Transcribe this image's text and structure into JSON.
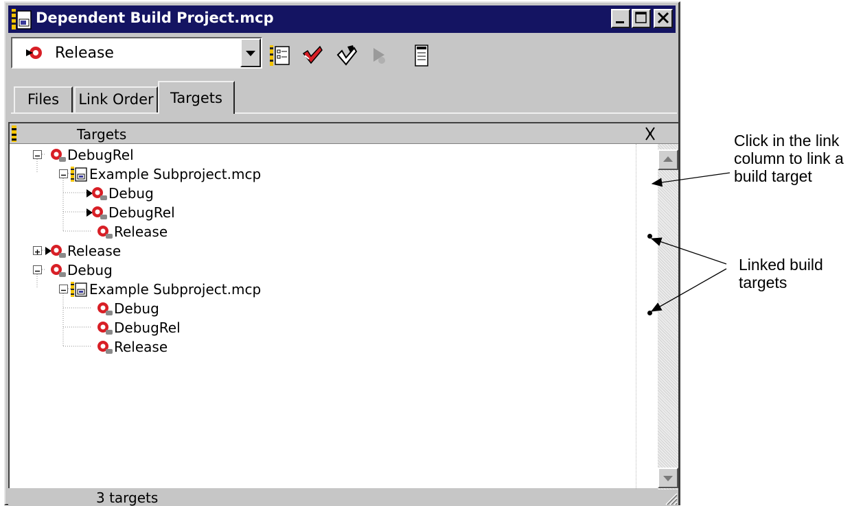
{
  "window": {
    "title": "Dependent Build Project.mcp",
    "controls": [
      "minimize",
      "maximize",
      "close"
    ]
  },
  "toolbar": {
    "target_selector_value": "Release",
    "buttons": [
      "settings-icon",
      "check-syntax-icon",
      "make-icon",
      "run-icon",
      "project-inspector-icon"
    ]
  },
  "tabs": [
    {
      "label": "Files",
      "active": false
    },
    {
      "label": "Link Order",
      "active": false
    },
    {
      "label": "Targets",
      "active": true
    }
  ],
  "list": {
    "column_header": "Targets",
    "tree": [
      {
        "label": "DebugRel",
        "type": "target",
        "level": 0,
        "expander": "minus",
        "linked": false
      },
      {
        "label": "Example Subproject.mcp",
        "type": "subproject",
        "level": 1,
        "expander": "minus",
        "linked": false
      },
      {
        "label": "Debug",
        "type": "target",
        "level": 2,
        "active_marker": true,
        "linked": false
      },
      {
        "label": "DebugRel",
        "type": "target",
        "level": 2,
        "active_marker": true,
        "linked": false
      },
      {
        "label": "Release",
        "type": "target",
        "level": 2,
        "active_marker": false,
        "linked": true
      },
      {
        "label": "Release",
        "type": "target",
        "level": 0,
        "expander": "plus",
        "active_marker": true,
        "linked": false
      },
      {
        "label": "Debug",
        "type": "target",
        "level": 0,
        "expander": "minus",
        "linked": false
      },
      {
        "label": "Example Subproject.mcp",
        "type": "subproject",
        "level": 1,
        "expander": "minus",
        "linked": false
      },
      {
        "label": "Debug",
        "type": "target",
        "level": 2,
        "active_marker": false,
        "linked": true
      },
      {
        "label": "DebugRel",
        "type": "target",
        "level": 2,
        "active_marker": false,
        "linked": false
      },
      {
        "label": "Release",
        "type": "target",
        "level": 2,
        "active_marker": false,
        "linked": false
      }
    ]
  },
  "status": {
    "text": "3 targets"
  },
  "callouts": {
    "link_column": [
      "Click in the link",
      "column to link a",
      "build target"
    ],
    "linked_targets": [
      "Linked build",
      "targets"
    ]
  },
  "colors": {
    "titlebar": "#141462",
    "window_face": "#c6c6c6",
    "target_icon_red": "#d81f26"
  }
}
